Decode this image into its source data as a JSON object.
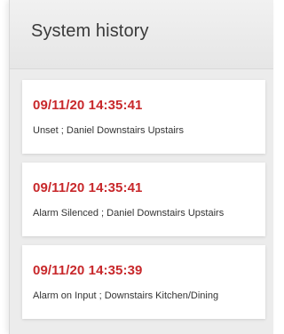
{
  "header": {
    "title": "System history"
  },
  "events": [
    {
      "time": "09/11/20 14:35:41",
      "description": "Unset ; Daniel Downstairs Upstairs"
    },
    {
      "time": "09/11/20 14:35:41",
      "description": "Alarm Silenced ; Daniel Downstairs Upstairs"
    },
    {
      "time": "09/11/20 14:35:39",
      "description": "Alarm on Input ; Downstairs Kitchen/Dining"
    }
  ],
  "colors": {
    "accent_red": "#c8282b",
    "panel_background": "#ececec"
  }
}
